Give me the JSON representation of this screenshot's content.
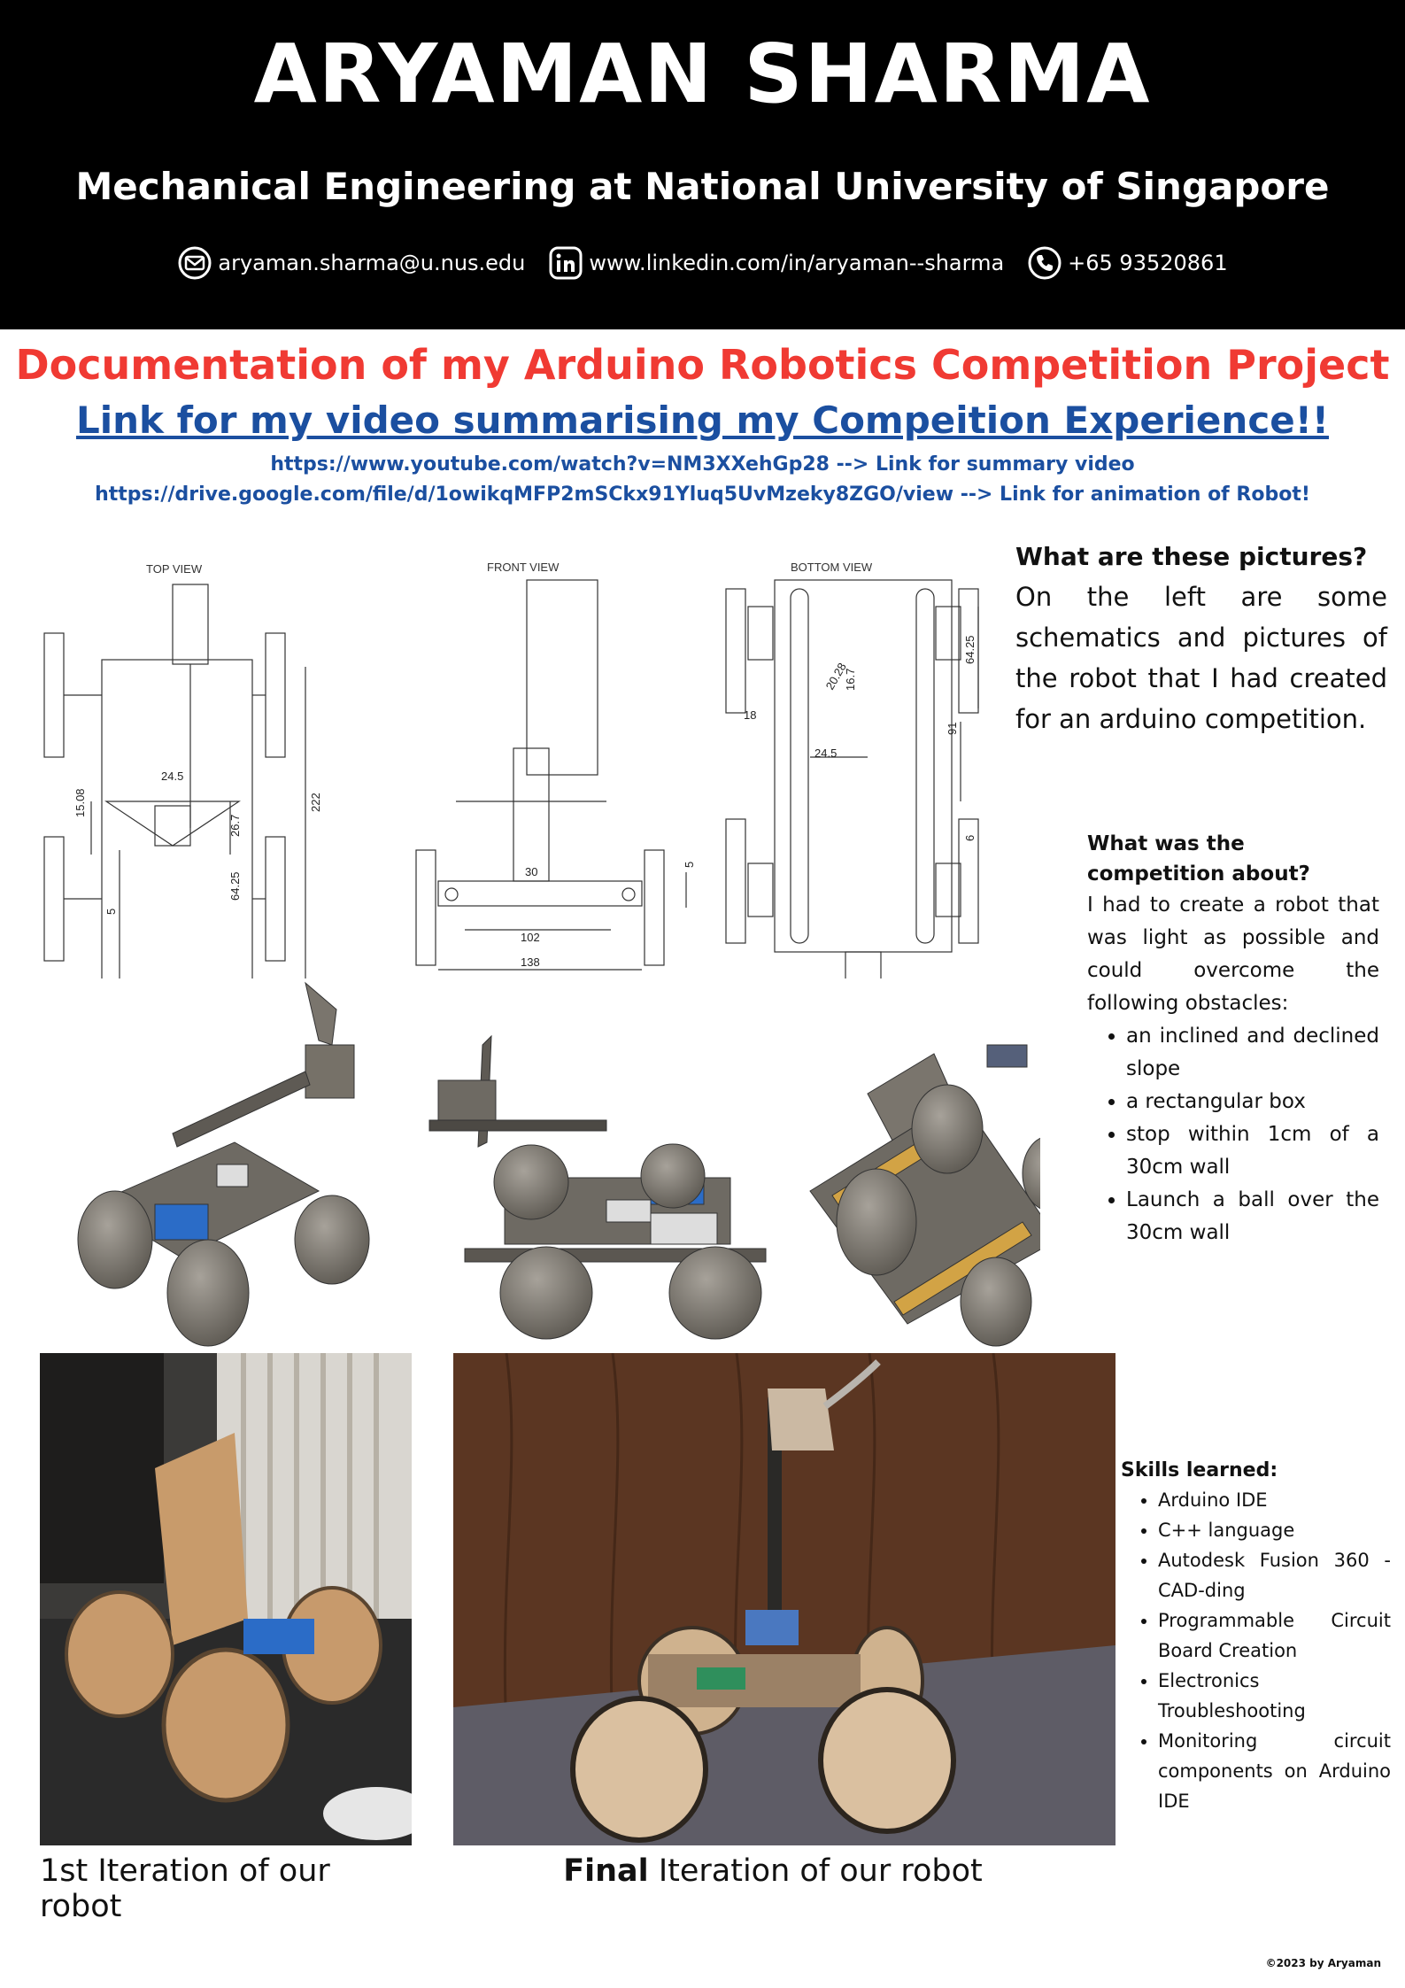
{
  "header": {
    "name": "ARYAMAN SHARMA",
    "subtitle": "Mechanical Engineering at National University of Singapore",
    "contacts": {
      "email": "aryaman.sharma@u.nus.edu",
      "email_icon": "mail-icon",
      "linkedin": "www.linkedin.com/in/aryaman--sharma",
      "linkedin_icon": "linkedin-icon",
      "phone": "+65 93520861",
      "phone_icon": "phone-icon"
    }
  },
  "title": "Documentation of my Arduino Robotics Competition Project",
  "video_heading": "Link for my video summarising my Compeition Experience!!",
  "links": {
    "video": "https://www.youtube.com/watch?v=NM3XXehGp28 --> Link for summary video",
    "animation": "https://drive.google.com/file/d/1owikqMFP2mSCkx91Yluq5UvMzeky8ZGO/view --> Link for animation of Robot!"
  },
  "schematics": {
    "top_view": "TOP VIEW",
    "front_view": "FRONT VIEW",
    "bottom_view": "BOTTOM VIEW",
    "dims_top": [
      "24.5",
      "15.08",
      "26.7",
      "222",
      "64.25",
      "5"
    ],
    "dims_front": [
      "30",
      "5",
      "102",
      "138"
    ],
    "dims_bottom": [
      "20.28",
      "16.7",
      "64.25",
      "18",
      "91",
      "24.5",
      "6"
    ]
  },
  "pictures_block": {
    "heading": "What are these pictures?",
    "body": "On the left are some schematics and pictures of the robot that I had created for an arduino competition."
  },
  "competition_block": {
    "heading": "What was the competition about?",
    "body": "I had to create a robot that was light as possible and could overcome the following obstacles:",
    "items": [
      "an inclined and declined slope",
      "a rectangular box",
      "stop within 1cm of a 30cm wall",
      "Launch a ball over the 30cm wall"
    ]
  },
  "skills_block": {
    "heading": "Skills learned:",
    "items": [
      "Arduino IDE",
      "C++ language",
      "Autodesk Fusion 360 - CAD-ding",
      "Programmable Circuit Board Creation",
      "Electronics Troubleshooting",
      "Monitoring circuit components on Arduino IDE"
    ]
  },
  "captions": {
    "first": "1st Iteration of our robot",
    "final_bold": "Final",
    "final_rest": " Iteration of our robot"
  },
  "copyright": "©2023 by Aryaman",
  "colors": {
    "header_bg": "#000000",
    "title_red": "#f03a33",
    "link_blue": "#1b4fa0"
  }
}
